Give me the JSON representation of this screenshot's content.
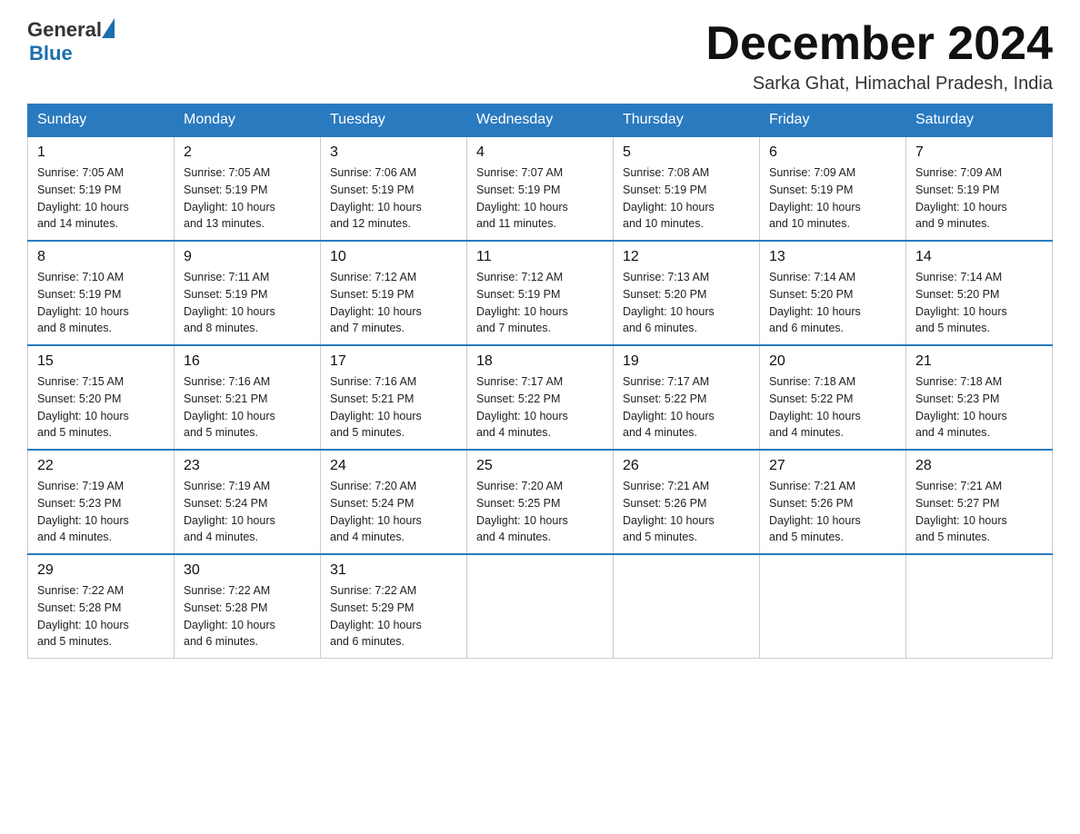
{
  "header": {
    "logo_general": "General",
    "logo_blue": "Blue",
    "month_title": "December 2024",
    "subtitle": "Sarka Ghat, Himachal Pradesh, India"
  },
  "days_of_week": [
    "Sunday",
    "Monday",
    "Tuesday",
    "Wednesday",
    "Thursday",
    "Friday",
    "Saturday"
  ],
  "weeks": [
    [
      {
        "day": "1",
        "sunrise": "7:05 AM",
        "sunset": "5:19 PM",
        "daylight": "10 hours and 14 minutes."
      },
      {
        "day": "2",
        "sunrise": "7:05 AM",
        "sunset": "5:19 PM",
        "daylight": "10 hours and 13 minutes."
      },
      {
        "day": "3",
        "sunrise": "7:06 AM",
        "sunset": "5:19 PM",
        "daylight": "10 hours and 12 minutes."
      },
      {
        "day": "4",
        "sunrise": "7:07 AM",
        "sunset": "5:19 PM",
        "daylight": "10 hours and 11 minutes."
      },
      {
        "day": "5",
        "sunrise": "7:08 AM",
        "sunset": "5:19 PM",
        "daylight": "10 hours and 10 minutes."
      },
      {
        "day": "6",
        "sunrise": "7:09 AM",
        "sunset": "5:19 PM",
        "daylight": "10 hours and 10 minutes."
      },
      {
        "day": "7",
        "sunrise": "7:09 AM",
        "sunset": "5:19 PM",
        "daylight": "10 hours and 9 minutes."
      }
    ],
    [
      {
        "day": "8",
        "sunrise": "7:10 AM",
        "sunset": "5:19 PM",
        "daylight": "10 hours and 8 minutes."
      },
      {
        "day": "9",
        "sunrise": "7:11 AM",
        "sunset": "5:19 PM",
        "daylight": "10 hours and 8 minutes."
      },
      {
        "day": "10",
        "sunrise": "7:12 AM",
        "sunset": "5:19 PM",
        "daylight": "10 hours and 7 minutes."
      },
      {
        "day": "11",
        "sunrise": "7:12 AM",
        "sunset": "5:19 PM",
        "daylight": "10 hours and 7 minutes."
      },
      {
        "day": "12",
        "sunrise": "7:13 AM",
        "sunset": "5:20 PM",
        "daylight": "10 hours and 6 minutes."
      },
      {
        "day": "13",
        "sunrise": "7:14 AM",
        "sunset": "5:20 PM",
        "daylight": "10 hours and 6 minutes."
      },
      {
        "day": "14",
        "sunrise": "7:14 AM",
        "sunset": "5:20 PM",
        "daylight": "10 hours and 5 minutes."
      }
    ],
    [
      {
        "day": "15",
        "sunrise": "7:15 AM",
        "sunset": "5:20 PM",
        "daylight": "10 hours and 5 minutes."
      },
      {
        "day": "16",
        "sunrise": "7:16 AM",
        "sunset": "5:21 PM",
        "daylight": "10 hours and 5 minutes."
      },
      {
        "day": "17",
        "sunrise": "7:16 AM",
        "sunset": "5:21 PM",
        "daylight": "10 hours and 5 minutes."
      },
      {
        "day": "18",
        "sunrise": "7:17 AM",
        "sunset": "5:22 PM",
        "daylight": "10 hours and 4 minutes."
      },
      {
        "day": "19",
        "sunrise": "7:17 AM",
        "sunset": "5:22 PM",
        "daylight": "10 hours and 4 minutes."
      },
      {
        "day": "20",
        "sunrise": "7:18 AM",
        "sunset": "5:22 PM",
        "daylight": "10 hours and 4 minutes."
      },
      {
        "day": "21",
        "sunrise": "7:18 AM",
        "sunset": "5:23 PM",
        "daylight": "10 hours and 4 minutes."
      }
    ],
    [
      {
        "day": "22",
        "sunrise": "7:19 AM",
        "sunset": "5:23 PM",
        "daylight": "10 hours and 4 minutes."
      },
      {
        "day": "23",
        "sunrise": "7:19 AM",
        "sunset": "5:24 PM",
        "daylight": "10 hours and 4 minutes."
      },
      {
        "day": "24",
        "sunrise": "7:20 AM",
        "sunset": "5:24 PM",
        "daylight": "10 hours and 4 minutes."
      },
      {
        "day": "25",
        "sunrise": "7:20 AM",
        "sunset": "5:25 PM",
        "daylight": "10 hours and 4 minutes."
      },
      {
        "day": "26",
        "sunrise": "7:21 AM",
        "sunset": "5:26 PM",
        "daylight": "10 hours and 5 minutes."
      },
      {
        "day": "27",
        "sunrise": "7:21 AM",
        "sunset": "5:26 PM",
        "daylight": "10 hours and 5 minutes."
      },
      {
        "day": "28",
        "sunrise": "7:21 AM",
        "sunset": "5:27 PM",
        "daylight": "10 hours and 5 minutes."
      }
    ],
    [
      {
        "day": "29",
        "sunrise": "7:22 AM",
        "sunset": "5:28 PM",
        "daylight": "10 hours and 5 minutes."
      },
      {
        "day": "30",
        "sunrise": "7:22 AM",
        "sunset": "5:28 PM",
        "daylight": "10 hours and 6 minutes."
      },
      {
        "day": "31",
        "sunrise": "7:22 AM",
        "sunset": "5:29 PM",
        "daylight": "10 hours and 6 minutes."
      },
      null,
      null,
      null,
      null
    ]
  ],
  "labels": {
    "sunrise": "Sunrise:",
    "sunset": "Sunset:",
    "daylight": "Daylight:"
  }
}
